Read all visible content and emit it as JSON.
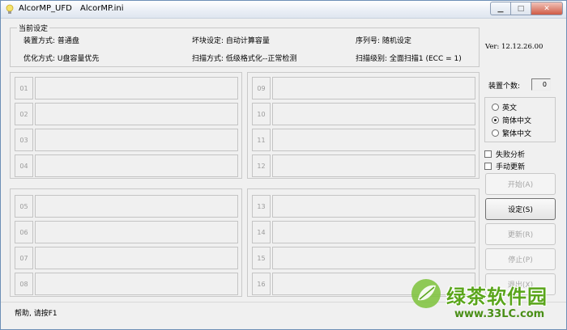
{
  "window": {
    "title_app": "AlcorMP_UFD",
    "title_file": "AlcorMP.ini",
    "minimize_glyph": "▁",
    "maximize_glyph": "□",
    "close_glyph": "✕",
    "icon": "bulb-icon"
  },
  "settings": {
    "group_title": "当前设定",
    "device_mode": "装置方式: 普通盘",
    "bad_block": "坏块设定: 自动计算容量",
    "serial": "序列号: 随机设定",
    "optimize": "优化方式: U盘容量优先",
    "scan_mode": "扫描方式: 低级格式化--正常检测",
    "scan_level": "扫描级别: 全面扫描1 (ECC = 1)"
  },
  "version": "Ver: 12.12.26.00",
  "slots": {
    "group1": [
      "01",
      "02",
      "03",
      "04"
    ],
    "group2": [
      "09",
      "10",
      "11",
      "12"
    ],
    "group3": [
      "05",
      "06",
      "07",
      "08"
    ],
    "group4": [
      "13",
      "14",
      "15",
      "16"
    ]
  },
  "device_count": {
    "label": "装置个数:",
    "value": "0"
  },
  "language": {
    "options": [
      "英文",
      "简体中文",
      "繁体中文"
    ],
    "selected": "简体中文"
  },
  "checks": {
    "fail_analysis": "失败分析",
    "manual_update": "手动更新"
  },
  "buttons": {
    "start": "开始(A)",
    "settings": "设定(S)",
    "update": "更新(R)",
    "stop": "停止(P)",
    "exit": "退出(X)"
  },
  "status_bar": "帮助, 请按F1",
  "watermark": {
    "text": "绿茶软件园",
    "url": "www.33LC.com",
    "brand_color": "#5aa51b"
  }
}
